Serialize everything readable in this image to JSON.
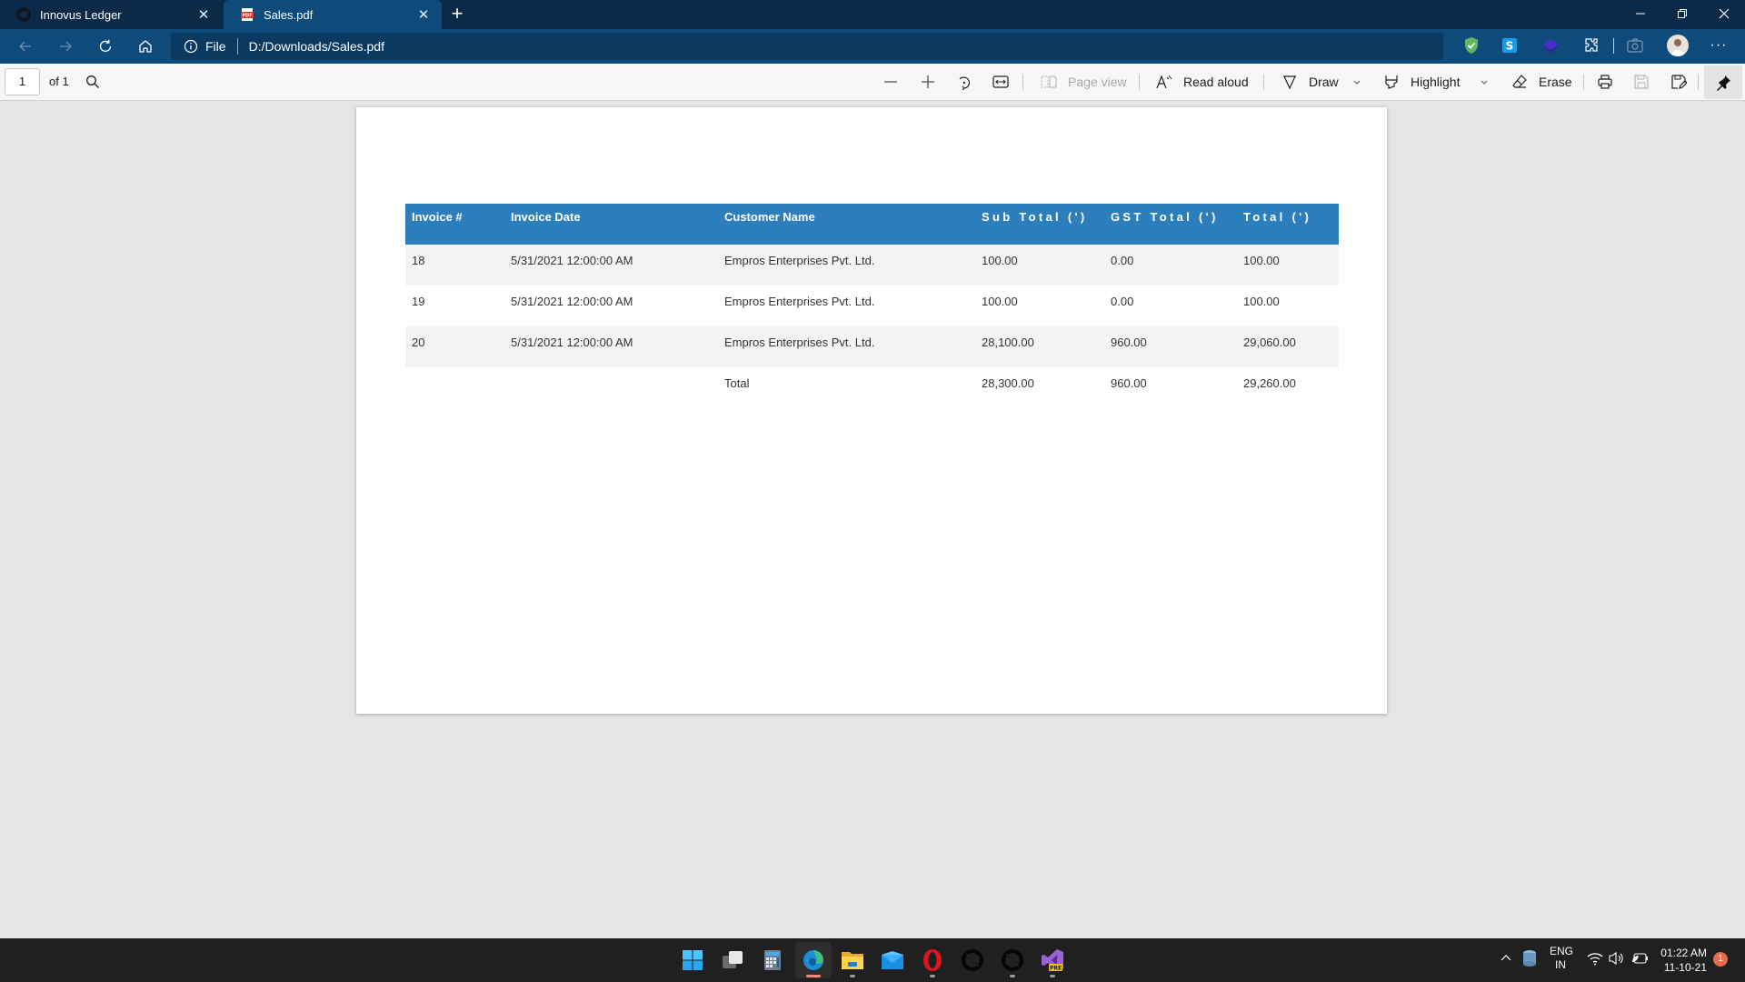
{
  "browser": {
    "tabs": [
      {
        "title": "Innovus Ledger",
        "icon": "innovus-logo-icon",
        "active": false
      },
      {
        "title": "Sales.pdf",
        "icon": "pdf-file-icon",
        "active": true
      }
    ],
    "address": {
      "scheme_label": "File",
      "url": "D:/Downloads/Sales.pdf"
    },
    "extensions": [
      "favorites-add-icon",
      "adguard-shield-icon",
      "s-extension-icon",
      "layers-extension-icon",
      "extensions-puzzle-icon",
      "screenshot-icon",
      "profile-avatar",
      "more-menu-icon"
    ]
  },
  "pdf_toolbar": {
    "page_current": "1",
    "page_of": "of 1",
    "page_view_label": "Page view",
    "read_aloud_label": "Read aloud",
    "draw_label": "Draw",
    "highlight_label": "Highlight",
    "erase_label": "Erase"
  },
  "document": {
    "table": {
      "headers": [
        "Invoice #",
        "Invoice Date",
        "Customer Name",
        "Sub Total (')",
        "GST Total (')",
        "Total (')"
      ],
      "rows": [
        {
          "invoice": "18",
          "date": "5/31/2021 12:00:00 AM",
          "customer": "Empros Enterprises Pvt. Ltd.",
          "sub_total": "100.00",
          "gst_total": "0.00",
          "total": "100.00"
        },
        {
          "invoice": "19",
          "date": "5/31/2021 12:00:00 AM",
          "customer": "Empros Enterprises Pvt. Ltd.",
          "sub_total": "100.00",
          "gst_total": "0.00",
          "total": "100.00"
        },
        {
          "invoice": "20",
          "date": "5/31/2021 12:00:00 AM",
          "customer": "Empros Enterprises Pvt. Ltd.",
          "sub_total": "28,100.00",
          "gst_total": "960.00",
          "total": "29,060.00"
        }
      ],
      "totals": {
        "label": "Total",
        "sub_total": "28,300.00",
        "gst_total": "960.00",
        "total": "29,260.00"
      }
    },
    "header_color": "#2c7ebc"
  },
  "taskbar": {
    "apps": [
      "start",
      "task-view",
      "calculator",
      "edge",
      "file-explorer",
      "mail",
      "opera",
      "innovus",
      "innovus",
      "visual-studio-preview"
    ],
    "tray": {
      "language_line1": "ENG",
      "language_line2": "IN",
      "time": "01:22 AM",
      "date": "11-10-21",
      "notification_count": "1"
    }
  }
}
